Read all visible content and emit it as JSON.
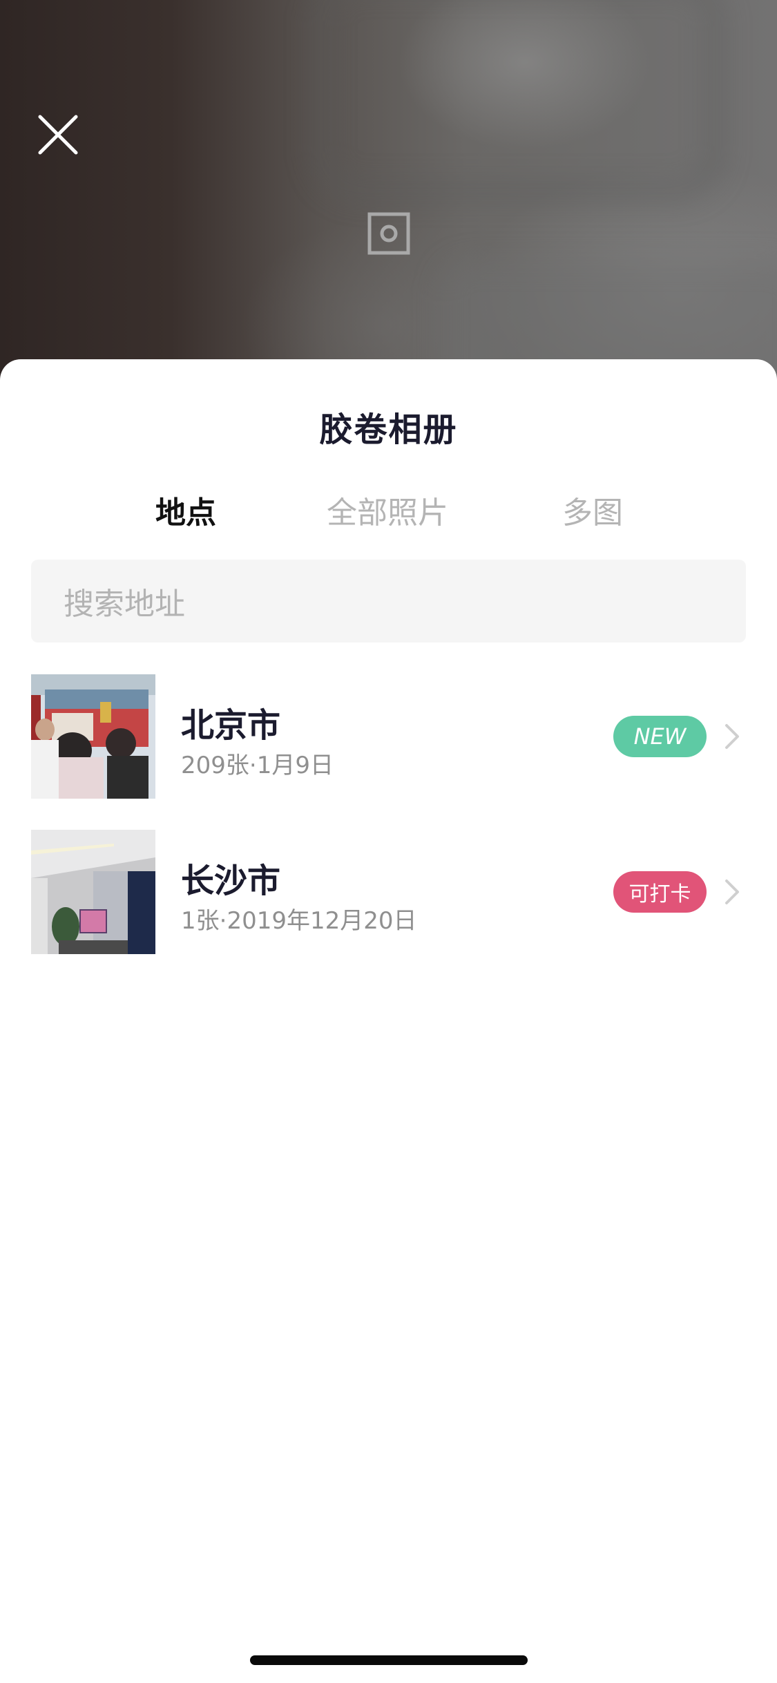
{
  "sheet": {
    "title": "胶卷相册"
  },
  "tabs": [
    {
      "label": "地点",
      "active": true
    },
    {
      "label": "全部照片",
      "active": false
    },
    {
      "label": "多图",
      "active": false
    }
  ],
  "search": {
    "placeholder": "搜索地址"
  },
  "locations": [
    {
      "name": "北京市",
      "subtitle": "209张·1月9日",
      "badge": "NEW",
      "badge_color": "#5ecaa4"
    },
    {
      "name": "长沙市",
      "subtitle": "1张·2019年12月20日",
      "badge": "可打卡",
      "badge_color": "#e15478"
    }
  ],
  "icons": {
    "close": "close-icon",
    "focus": "focus-frame-icon",
    "chevron": "chevron-right-icon"
  }
}
